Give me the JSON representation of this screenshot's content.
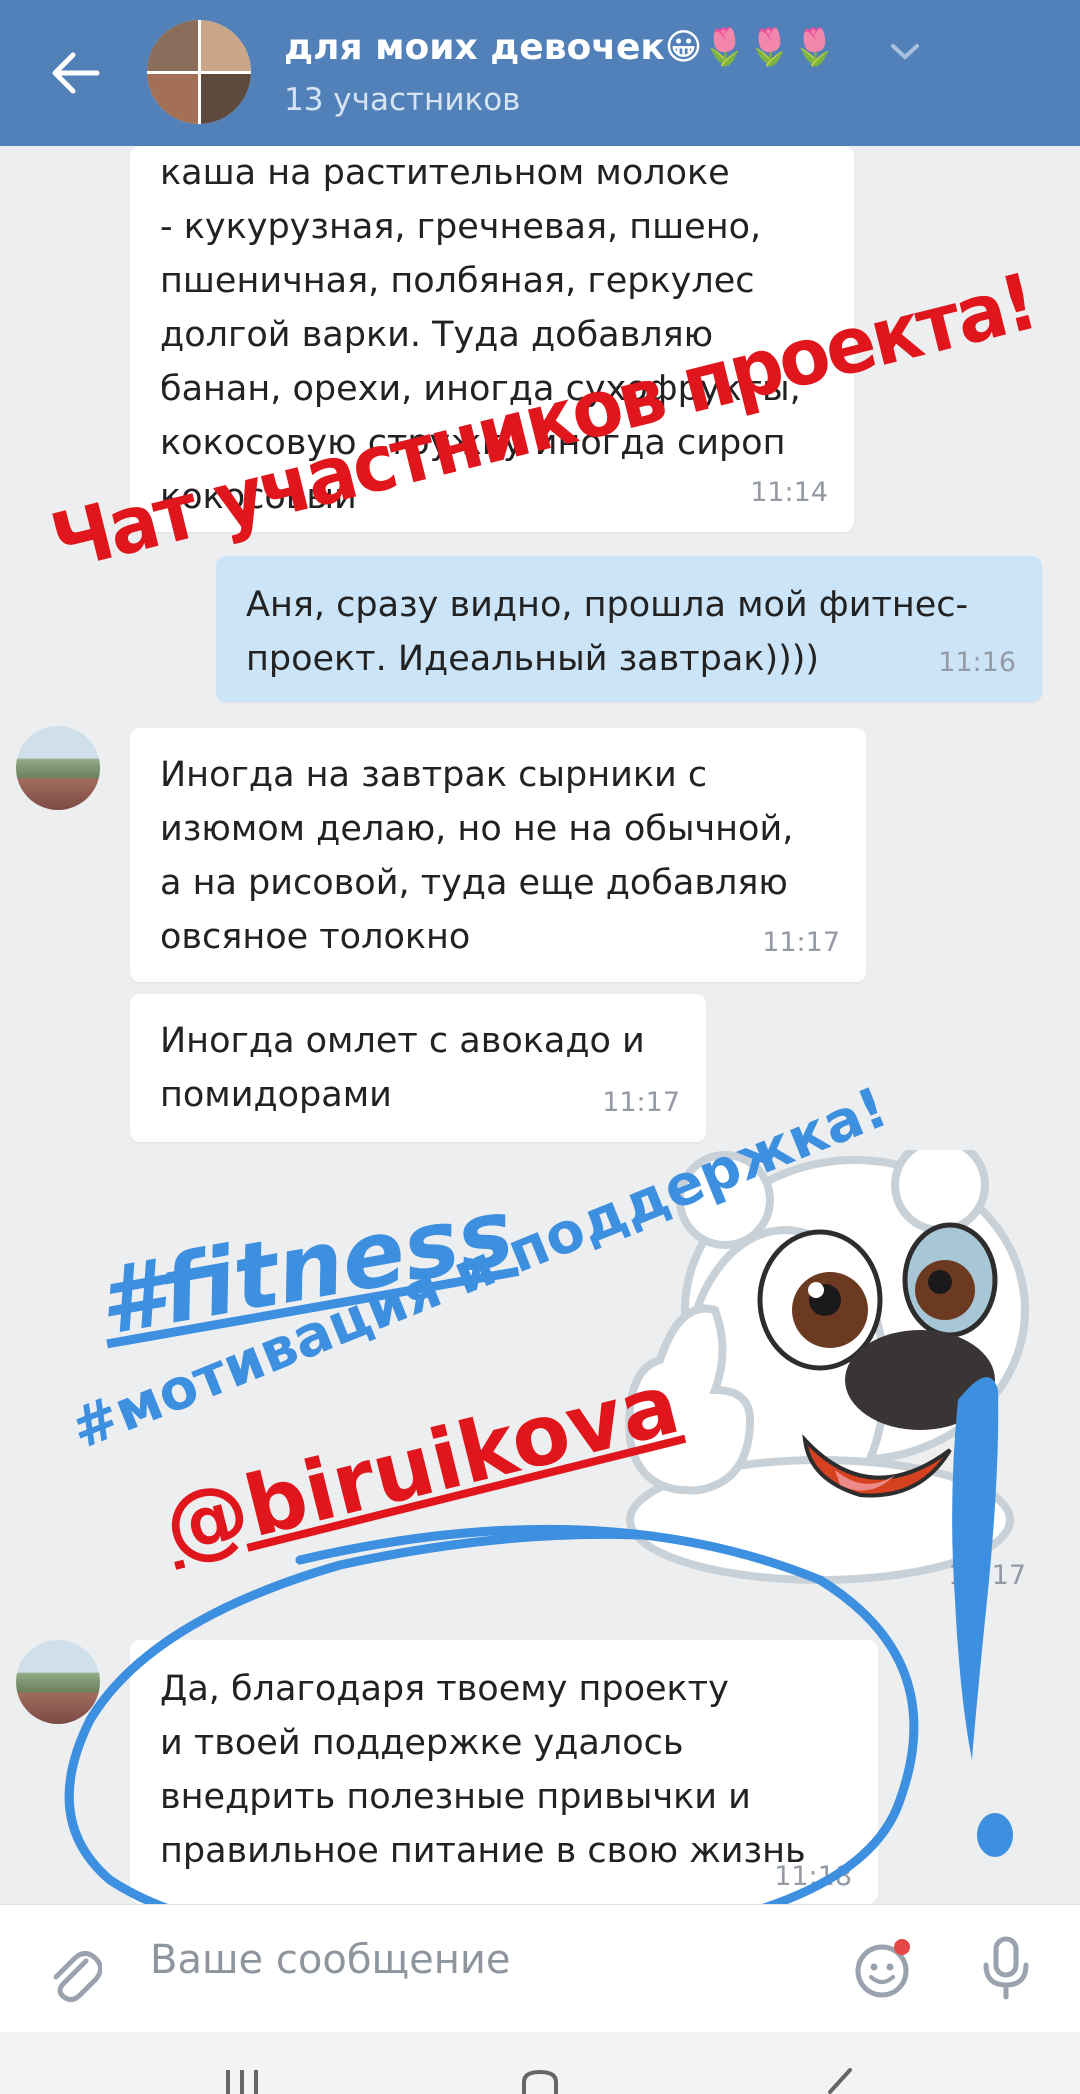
{
  "header": {
    "back_icon": "arrow-left-icon",
    "title": "для моих девочек😀🌷🌷🌷",
    "subtitle": "13 участников",
    "dropdown_icon": "chevron-down-icon"
  },
  "messages": [
    {
      "text": "каша на растительном молоке\n- кукурузная, гречневая, пшено,\nпшеничная, полбяная, геркулес\nдолгой варки. Туда добавляю\nбанан, орехи, иногда сухофрукты,\nкокосовую стружку иногда сироп\nкокосовый",
      "time": "11:14",
      "direction": "in"
    },
    {
      "text": "Аня, сразу видно, прошла мой фитнес-\nпроект. Идеальный завтрак))))",
      "time": "11:16",
      "direction": "out"
    },
    {
      "text": "Иногда на завтрак сырники с\nизюмом делаю, но не на обычной,\nа на рисовой, туда еще добавляю\nовсяное толокно",
      "time": "11:17",
      "direction": "in"
    },
    {
      "text": "Иногда омлет с авокадо и\nпомидорами",
      "time": "11:17",
      "direction": "in"
    },
    {
      "text": "",
      "time": "11:17",
      "direction": "in",
      "kind": "sticker"
    },
    {
      "text": "Да, благодаря твоему проекту\nи твоей поддержке удалось\nвнедрить полезные привычки и\nправильное питание в свою жизнь",
      "time": "11:18",
      "direction": "in"
    }
  ],
  "overlays": {
    "chat_caption": "Чат участников проекта!",
    "hashtag_fitness": "#fitness",
    "hashtag_motivation": "#мотивация и поддержка!",
    "mention": "@biruikova"
  },
  "composer": {
    "attach_icon": "paperclip-icon",
    "placeholder": "Ваше сообщение",
    "sticker_icon": "smiley-icon",
    "mic_icon": "microphone-icon"
  },
  "colors": {
    "header_bg": "#5181b8",
    "incoming_bubble": "#ffffff",
    "outgoing_bubble": "#cce4f7",
    "overlay_red": "#e0161c",
    "overlay_blue": "#3d8fe0"
  }
}
